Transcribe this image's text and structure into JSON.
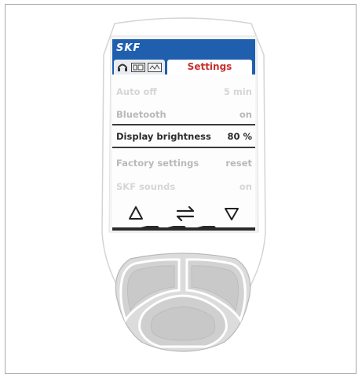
{
  "brand": {
    "logo": "SKF",
    "color": "#1f5fae"
  },
  "tabs": {
    "icons": [
      "headphones-icon",
      "tab-icon-1",
      "tab-icon-2"
    ],
    "active_label": "Settings",
    "active_color": "#c6302b"
  },
  "settings": [
    {
      "label": "Auto off",
      "value": "5 min",
      "state": "faint"
    },
    {
      "label": "Bluetooth",
      "value": "on",
      "state": "dim"
    },
    {
      "label": "Display brightness",
      "value": "80 %",
      "state": "selected"
    },
    {
      "label": "Factory settings",
      "value": "reset",
      "state": "dim"
    },
    {
      "label": "SKF sounds",
      "value": "on",
      "state": "faint"
    }
  ],
  "softkeys": [
    "up-arrow-icon",
    "swap-arrows-icon",
    "down-arrow-icon"
  ]
}
